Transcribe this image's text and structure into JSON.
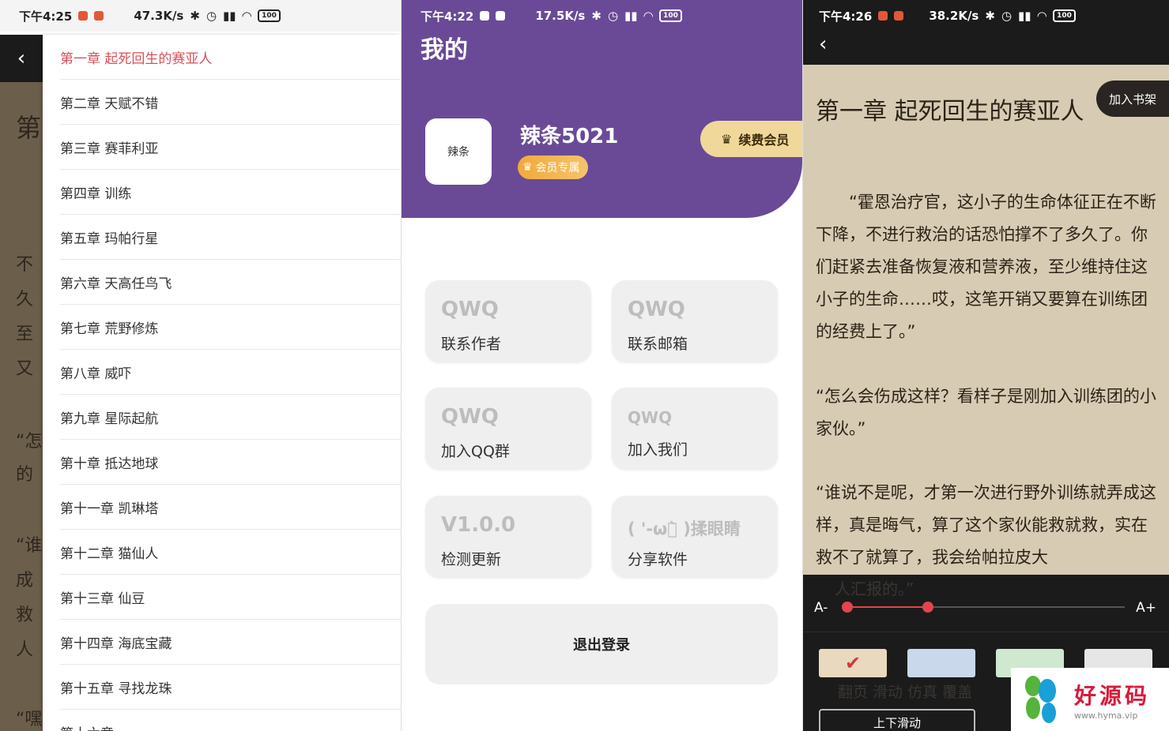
{
  "panel1": {
    "status": {
      "time": "下午4:25",
      "speed": "47.3K/s",
      "battery": "100"
    },
    "ghost_lines": [
      "第",
      "不",
      "久",
      "至",
      "又",
      "“怎",
      "的",
      "“谁",
      "成",
      "救",
      "人",
      "“嘿"
    ],
    "chapters": [
      "第一章 起死回生的赛亚人",
      "第二章 天赋不错",
      "第三章 赛菲利亚",
      "第四章 训练",
      "第五章 玛帕行星",
      "第六章 天高任鸟飞",
      "第七章 荒野修炼",
      "第八章 威吓",
      "第九章 星际起航",
      "第十章 抵达地球",
      "第十一章 凯琳塔",
      "第十二章 猫仙人",
      "第十三章 仙豆",
      "第十四章 海底宝藏",
      "第十五章 寻找龙珠",
      "第十六章 ……"
    ]
  },
  "panel2": {
    "status": {
      "time": "下午4:22",
      "speed": "17.5K/s",
      "battery": "100"
    },
    "title": "我的",
    "avatar_text": "辣条",
    "username": "辣条5021",
    "vip_badge": "会员专属",
    "renew_label": "续费会员",
    "cards": [
      {
        "big": "QWQ",
        "label": "联系作者"
      },
      {
        "big": "QWQ",
        "label": "联系邮箱"
      },
      {
        "big": "QWQ",
        "label": "加入QQ群"
      },
      {
        "big": "QWQ",
        "label": "加入我们"
      },
      {
        "big": "V1.0.0",
        "label": "检测更新"
      },
      {
        "big": "( '-ωก̀ )揉眼睛",
        "label": "分享软件"
      }
    ],
    "logout_label": "退出登录",
    "colors": {
      "hero": "#6a4a97"
    }
  },
  "panel3": {
    "status": {
      "time": "下午4:26",
      "speed": "38.2K/s",
      "battery": "100"
    },
    "chapter_title": "第一章 起死回生的赛亚人",
    "add_shelf": "加入书架",
    "paragraphs": [
      "“霍恩治疗官，这小子的生命体征正在不断下降，不进行救治的话恐怕撑不了多久了。你们赶紧去准备恢复液和营养液，至少维持住这小子的生命……哎，这笔开销又要算在训练团的经费上了。”",
      "“怎么会伤成这样？看样子是刚加入训练团的小家伙。”",
      "“谁说不是呢，才第一次进行野外训练就弄成这样，真是晦气，算了这个家伙能救就救，实在救不了就算了，我会给帕拉皮大"
    ],
    "ghost_line": "人汇报的。”",
    "font_minus": "A-",
    "font_plus": "A+",
    "font_level": 0.29,
    "swatches": [
      "#e8d9bf",
      "#c9d8ea",
      "#cfe8cf",
      "#e6e6e6"
    ],
    "ghost2": "翻页  滑动  仿真  覆盖",
    "scroll_label": "上下滑动"
  },
  "watermark": {
    "brand": "好源码",
    "url": "www.hyma.vip"
  }
}
